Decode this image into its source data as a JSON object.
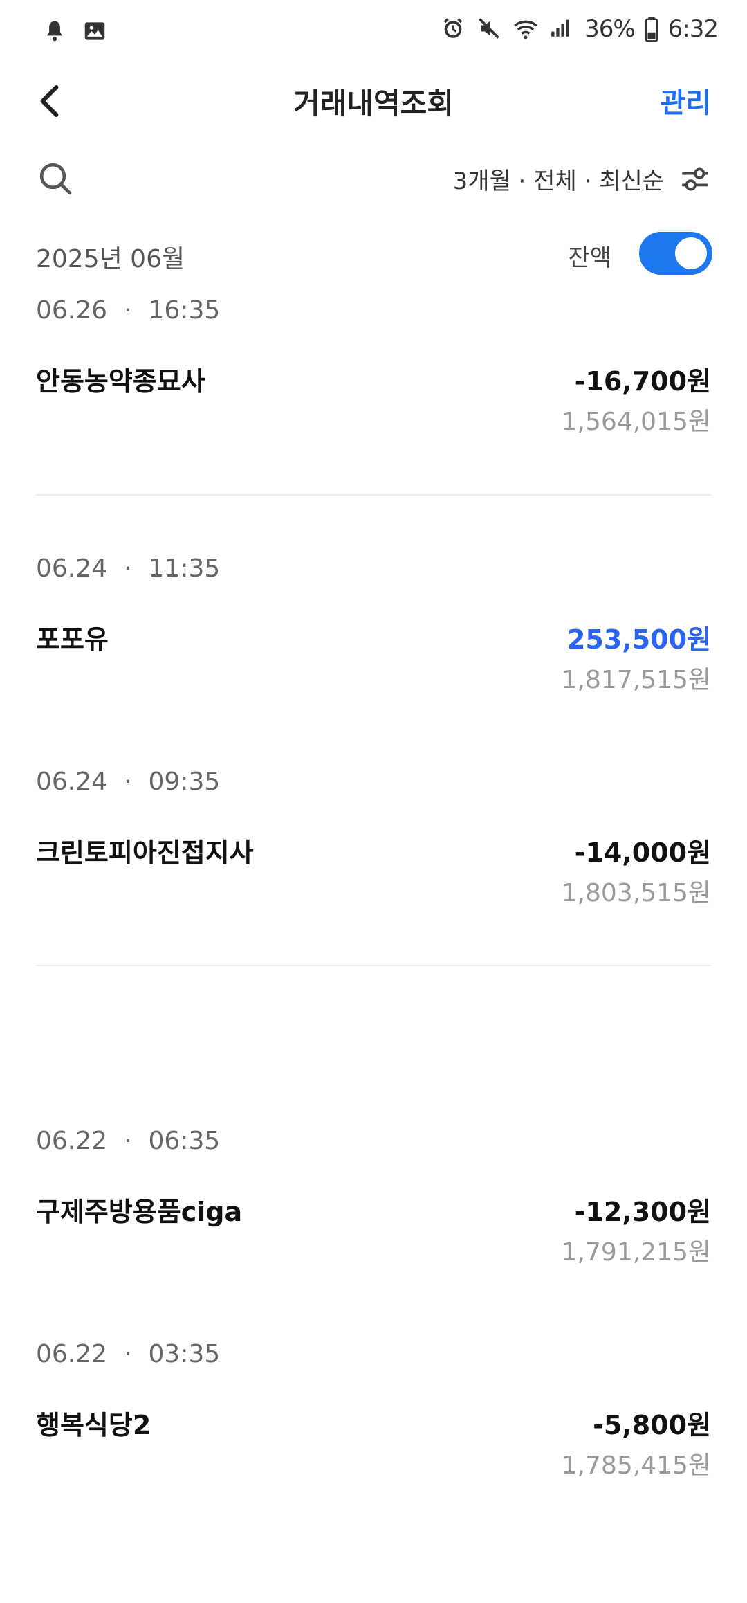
{
  "status_bar": {
    "left_icons": [
      "bell-icon",
      "image-icon"
    ],
    "right_icons": [
      "alarm-icon",
      "mute-icon",
      "wifi-icon",
      "signal-icon",
      "battery-icon"
    ],
    "battery": "36%",
    "time": "6:32"
  },
  "header": {
    "title": "거래내역조회",
    "manage_label": "관리"
  },
  "filter": {
    "summary": "3개월 · 전체 · 최신순"
  },
  "month_row": {
    "month": "2025년 06월",
    "balance_label": "잔액",
    "balance_toggle_on": true
  },
  "transactions": [
    {
      "date": "06.26",
      "dot": "·",
      "time": "16:35",
      "name": "안동농약종묘사",
      "amount": "-16,700원",
      "balance": "1,564,015원"
    },
    {
      "date": "06.24",
      "dot": "·",
      "time": "11:35",
      "name": "포포유",
      "amount": "253,500원",
      "balance": "1,817,515원"
    },
    {
      "date": "06.24",
      "dot": "·",
      "time": "09:35",
      "name": "크린토피아진접지사",
      "amount": "-14,000원",
      "balance": "1,803,515원"
    },
    {
      "date": "06.22",
      "dot": "·",
      "time": "06:35",
      "name": "구제주방용품ciga",
      "amount": "-12,300원",
      "balance": "1,791,215원"
    },
    {
      "date": "06.22",
      "dot": "·",
      "time": "03:35",
      "name": "행복식당2",
      "amount": "-5,800원",
      "balance": "1,785,415원"
    }
  ],
  "colors": {
    "accent": "#1e78f0",
    "income": "#2a64f0",
    "muted": "#9a9a9a"
  }
}
